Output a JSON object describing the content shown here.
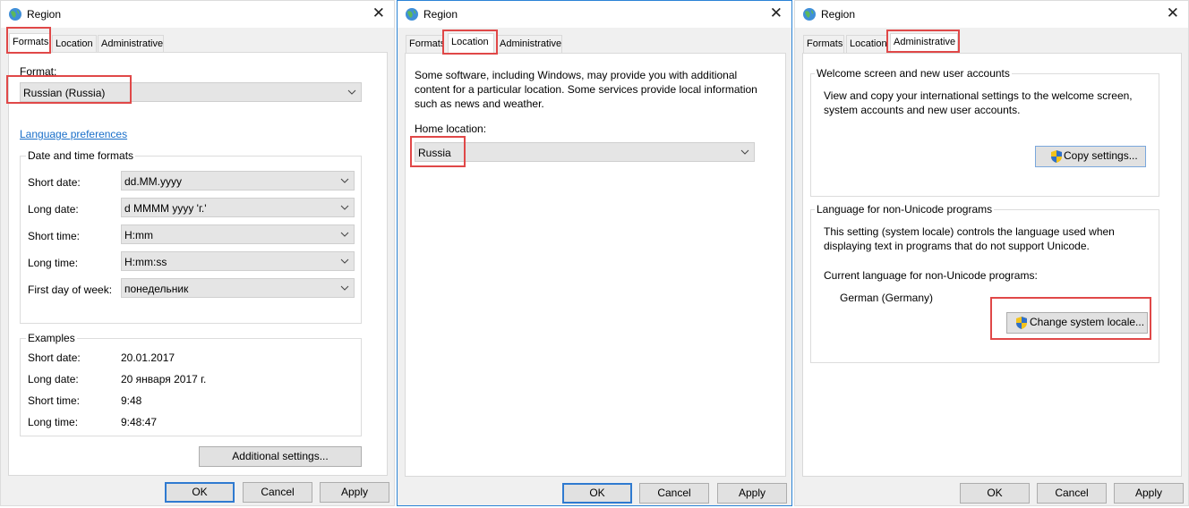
{
  "window_title": "Region",
  "tabs": {
    "formats": "Formats",
    "location": "Location",
    "administrative": "Administrative"
  },
  "formats": {
    "format_label": "Format:",
    "format_value": "Russian (Russia)",
    "language_link": "Language preferences",
    "datetime_group": "Date and time formats",
    "fields": [
      {
        "label": "Short date:",
        "value": "dd.MM.yyyy"
      },
      {
        "label": "Long date:",
        "value": "d MMMM yyyy 'г.'"
      },
      {
        "label": "Short time:",
        "value": "H:mm"
      },
      {
        "label": "Long time:",
        "value": "H:mm:ss"
      },
      {
        "label": "First day of week:",
        "value": "понедельник"
      }
    ],
    "examples_group": "Examples",
    "examples": [
      {
        "label": "Short date:",
        "value": "20.01.2017"
      },
      {
        "label": "Long date:",
        "value": "20 января 2017 г."
      },
      {
        "label": "Short time:",
        "value": "9:48"
      },
      {
        "label": "Long time:",
        "value": "9:48:47"
      }
    ],
    "additional_settings": "Additional settings..."
  },
  "location": {
    "description": "Some software, including Windows, may provide you with additional content for a particular location. Some services provide local information such as news and weather.",
    "home_label": "Home location:",
    "home_value": "Russia"
  },
  "administrative": {
    "welcome_group": "Welcome screen and new user accounts",
    "welcome_desc": "View and copy your international settings to the welcome screen, system accounts and new user accounts.",
    "copy_settings": "Copy settings...",
    "nonunicode_group": "Language for non-Unicode programs",
    "nonunicode_desc": "This setting (system locale) controls the language used when displaying text in programs that do not support Unicode.",
    "current_label": "Current language for non-Unicode programs:",
    "current_value": "German (Germany)",
    "change_locale": "Change system locale..."
  },
  "buttons": {
    "ok": "OK",
    "cancel": "Cancel",
    "apply": "Apply"
  },
  "colors": {
    "highlight": "#e04848",
    "link": "#1a6fc9",
    "accent": "#2f7ad0"
  }
}
